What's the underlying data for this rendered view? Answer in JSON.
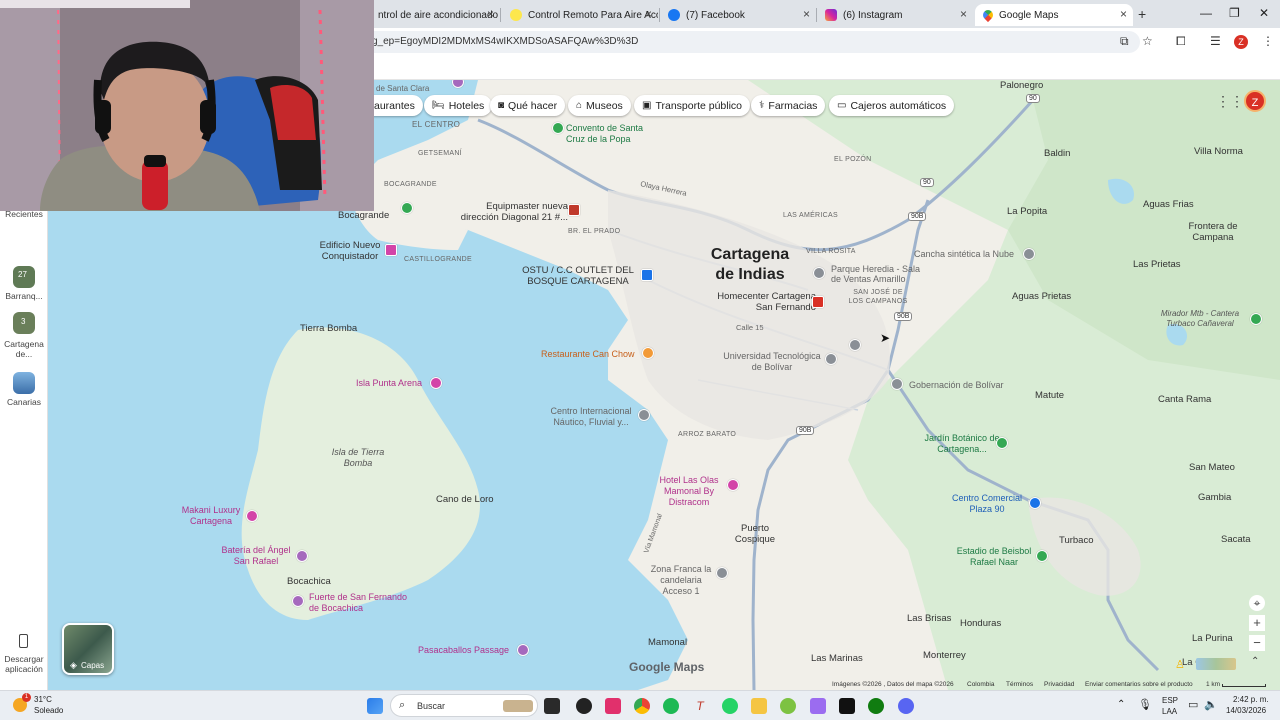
{
  "tabs": [
    {
      "label": "ntrol de aire acondicionado",
      "icon": "generic-page-icon"
    },
    {
      "label": "Control Remoto Para Aire Acon",
      "icon": "mercadolibre-icon"
    },
    {
      "label": "(7) Facebook",
      "icon": "facebook-icon"
    },
    {
      "label": "(6) Instagram",
      "icon": "instagram-icon"
    },
    {
      "label": "Google Maps",
      "icon": "google-maps-icon",
      "active": true
    }
  ],
  "address": {
    "url": "g_ep=EgoyMDI2MDMxMS4wIKXMDSoASAFQAw%3D%3D"
  },
  "profile": {
    "initial": "Z"
  },
  "chips": [
    {
      "label": "aurantes"
    },
    {
      "label": "Hoteles",
      "icon": "bed-icon"
    },
    {
      "label": "Qué hacer",
      "icon": "camera-icon"
    },
    {
      "label": "Museos",
      "icon": "museum-icon"
    },
    {
      "label": "Transporte público",
      "icon": "train-icon"
    },
    {
      "label": "Farmacias",
      "icon": "pharmacy-icon"
    },
    {
      "label": "Cajeros automáticos",
      "icon": "atm-icon"
    }
  ],
  "rail": {
    "recents": "Recientes",
    "items": [
      {
        "label": "Barranq...",
        "badge": "27"
      },
      {
        "label": "Cartagena de...",
        "badge": "3"
      },
      {
        "label": "Canarias"
      }
    ],
    "download": "Descargar aplicación"
  },
  "map": {
    "city": "Cartagena de Indias",
    "places": {
      "palonegro": "Palonegro",
      "baldin": "Baldin",
      "villa_norma": "Villa Norma",
      "la_popita": "La Popita",
      "aguas_frias": "Aguas Frias",
      "frontera": "Frontera de Campana",
      "las_prietas": "Las Prietas",
      "aguas_prietas": "Aguas Prietas",
      "mirador": "Mirador Mtb - Cantera Turbaco Cañaveral",
      "matute": "Matute",
      "canta_rama": "Canta Rama",
      "san_mateo": "San Mateo",
      "gambia": "Gambia",
      "turbaco": "Turbaco",
      "sacata": "Sacata",
      "las_brisas": "Las Brisas",
      "honduras": "Honduras",
      "la_purina": "La Purina",
      "la_co": "La Co",
      "las_marinas": "Las Marinas",
      "monterrey": "Monterrey",
      "tierra_bomba": "Tierra Bomba",
      "isla_tierra_bomba": "Isla de Tierra Bomba",
      "cano_de_loro": "Cano de Loro",
      "bocachica": "Bocachica",
      "puerto_cospique": "Puerto Cospique",
      "mamonal": "Mamonal",
      "el_centro": "EL CENTRO",
      "getsemani": "GETSEMANÍ",
      "bocagrande": "BOCAGRANDE",
      "castillogrande": "CASTILLOGRANDE",
      "br_el_prado": "BR. EL PRADO",
      "las_americas": "LAS AMÉRICAS",
      "el_pozon": "EL POZÓN",
      "villa_rosita": "VILLA ROSITA",
      "san_jose_campanos": "SAN JOSÉ DE LOS CAMPANOS",
      "arroz_barato": "ARROZ BARATO",
      "calle15": "Calle 15",
      "olaya": "Olaya Herrera",
      "santa_clara": "de Santa Clara",
      "vaucorte": "Vía Mamonal"
    },
    "pois": {
      "convento": "Convento de Santa Cruz de la Popa",
      "equipmaster": "Equipmaster nueva dirección Diagonal 21 #...",
      "ostu": "OSTU / C.C OUTLET DEL BOSQUE CARTAGENA",
      "parque_heredia": "Parque Heredia - Sala de Ventas Amarillo",
      "homecenter": "Homecenter Cartagena San Fernando",
      "cancha": "Cancha sintética la Nube",
      "restaurante": "Restaurante Can Chow",
      "universidad": "Universidad Tecnológica de Bolívar",
      "gobernacion": "Gobernación de Bolívar",
      "centro_nautico": "Centro Internacional Náutico, Fluvial y...",
      "jardin": "Jardín Botánico de Cartagena...",
      "hotel": "Hotel Las Olas Mamonal By Distracom",
      "centro_comercial": "Centro Comercial Plaza 90",
      "estadio": "Estadio de Beisbol Rafael Naar",
      "zona_franca": "Zona Franca la candelaria Acceso 1",
      "edificio": "Edificio Nuevo Conquistador",
      "bocagrande_poi": "Bocagrande",
      "isla_punta": "Isla Punta Arena",
      "makani": "Makani Luxury Cartagena",
      "bateria": "Batería del Ángel San Rafael",
      "fuerte": "Fuerte de San Fernando de Bocachica",
      "pasacaballos": "Pasacaballos Passage"
    },
    "shields": [
      "90",
      "90",
      "90B",
      "90B",
      "90B"
    ],
    "logo": "Google Maps",
    "layers": "Capas",
    "footer": {
      "images": "Imágenes ©2026 , Datos del mapa ©2026",
      "country": "Colombia",
      "terms": "Términos",
      "privacy": "Privacidad",
      "feedback": "Enviar comentarios sobre el producto",
      "scale": "1 km"
    }
  },
  "taskbar": {
    "weather_temp": "31°C",
    "weather_desc": "Soleado",
    "search": "Buscar",
    "lang_top": "ESP",
    "lang_bottom": "LAA",
    "time": "2:42 p. m.",
    "date": "14/03/2026",
    "weather_badge": "1"
  },
  "colors": {
    "water": "#aadaef",
    "land": "#f1efe9",
    "green": "#cde8c8",
    "road": "#9fb3cc",
    "accent_red": "#d93025"
  }
}
